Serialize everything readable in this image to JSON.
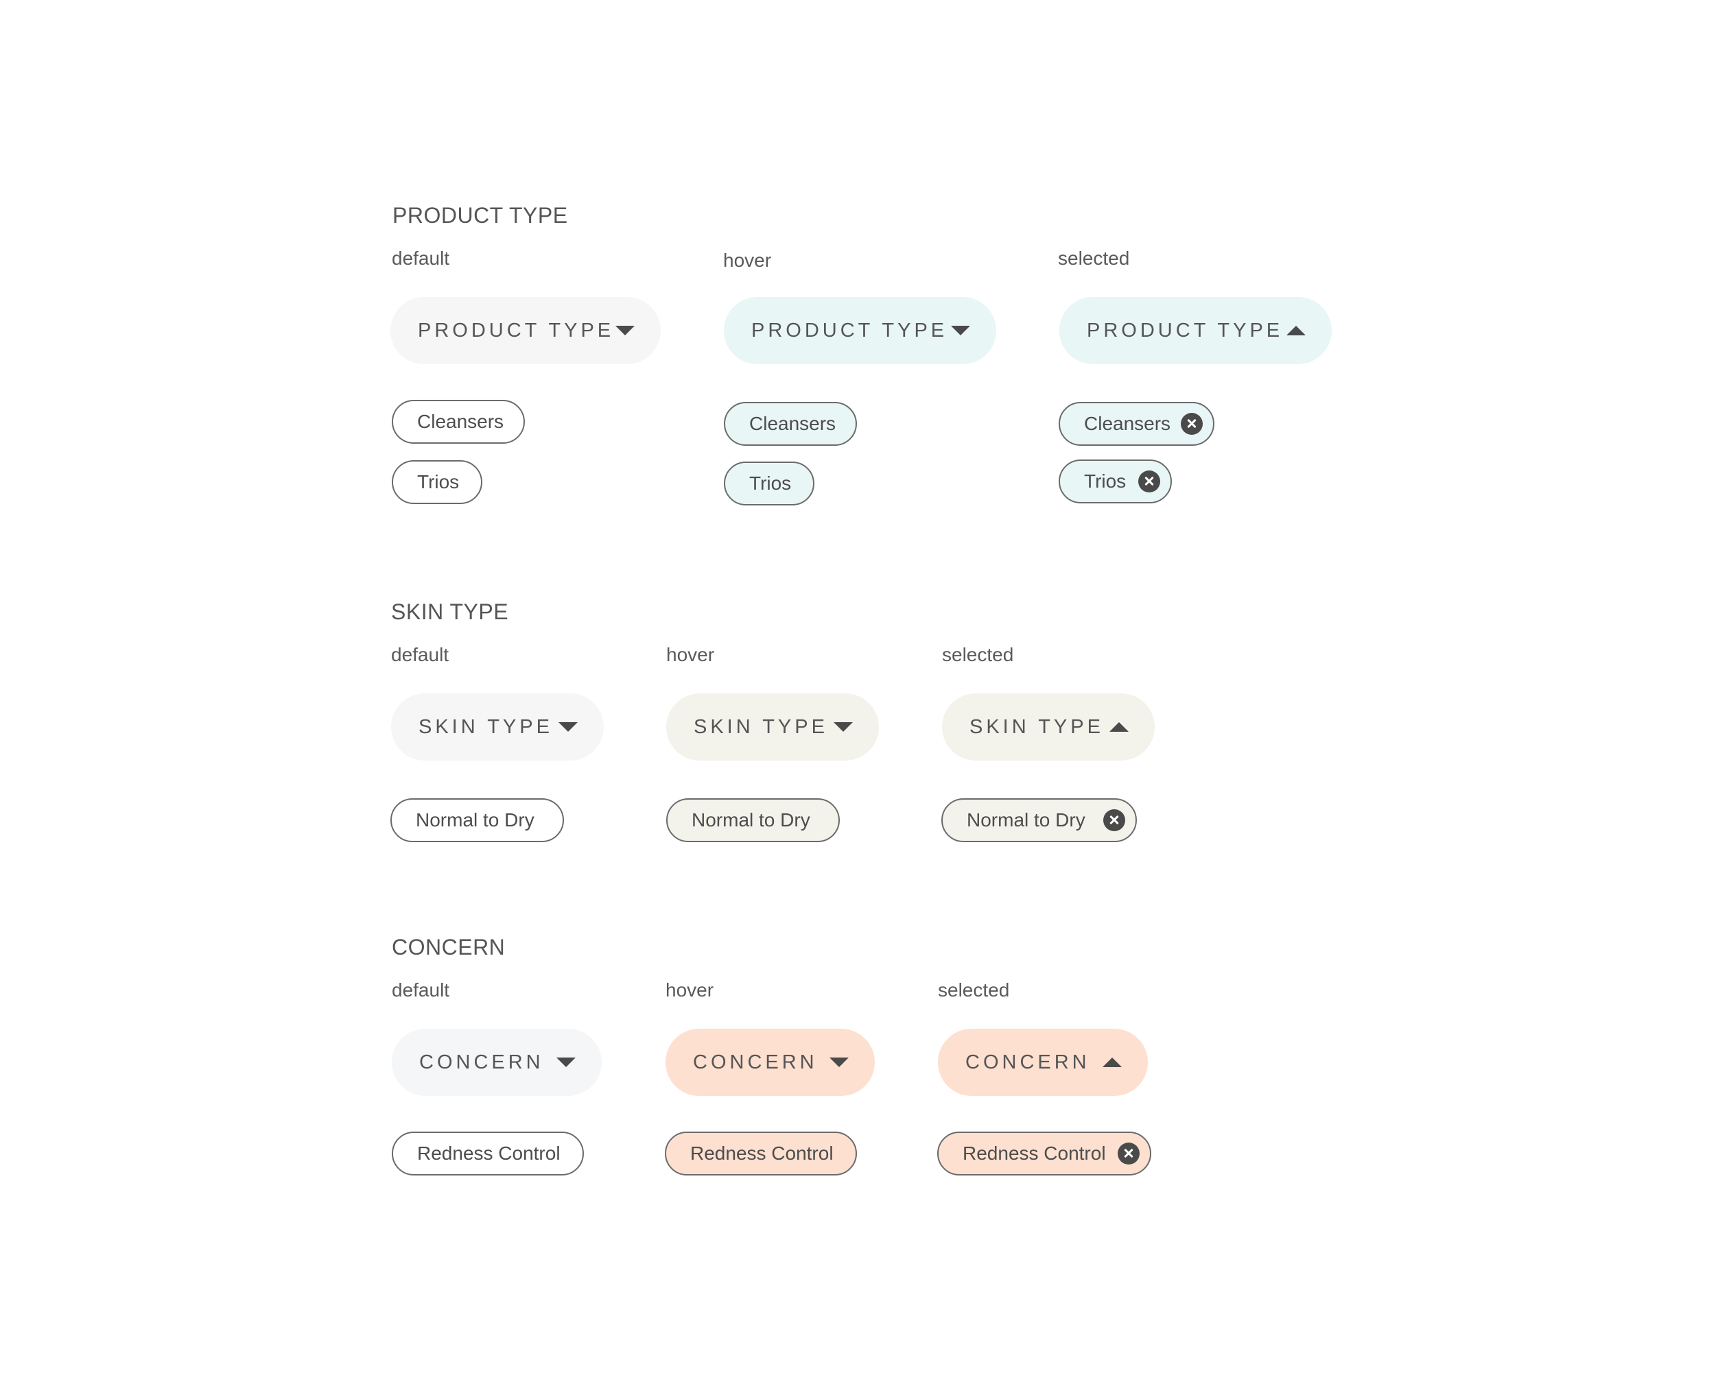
{
  "colors": {
    "default_bg": "#f6f6f6",
    "product_type_accent": "#e8f6f5",
    "skin_type_accent": "#f3f3eb",
    "concern_accent": "#fde0d0",
    "text": "#4d4d4d",
    "border": "#6b6b6b",
    "remove_icon": "#4a4a4a"
  },
  "sections": {
    "product_type": {
      "title": "PRODUCT TYPE",
      "default": {
        "state_label": "default",
        "dropdown_label": "PRODUCT TYPE",
        "caret_icon": "chevron-down-icon",
        "chips": [
          "Cleansers",
          "Trios"
        ]
      },
      "hover": {
        "state_label": "hover",
        "dropdown_label": "PRODUCT TYPE",
        "caret_icon": "chevron-down-icon",
        "chips": [
          "Cleansers",
          "Trios"
        ]
      },
      "selected": {
        "state_label": "selected",
        "dropdown_label": "PRODUCT TYPE",
        "caret_icon": "chevron-up-icon",
        "chips": [
          "Cleansers",
          "Trios"
        ],
        "chip_remove_icon": "close-circle-icon"
      }
    },
    "skin_type": {
      "title": "SKIN TYPE",
      "default": {
        "state_label": "default",
        "dropdown_label": "SKIN TYPE",
        "caret_icon": "chevron-down-icon",
        "chips": [
          "Normal to Dry"
        ]
      },
      "hover": {
        "state_label": "hover",
        "dropdown_label": "SKIN TYPE",
        "caret_icon": "chevron-down-icon",
        "chips": [
          "Normal to Dry"
        ]
      },
      "selected": {
        "state_label": "selected",
        "dropdown_label": "SKIN TYPE",
        "caret_icon": "chevron-up-icon",
        "chips": [
          "Normal to Dry"
        ],
        "chip_remove_icon": "close-circle-icon"
      }
    },
    "concern": {
      "title": "CONCERN",
      "default": {
        "state_label": "default",
        "dropdown_label": "CONCERN",
        "caret_icon": "chevron-down-icon",
        "chips": [
          "Redness Control"
        ]
      },
      "hover": {
        "state_label": "hover",
        "dropdown_label": "CONCERN",
        "caret_icon": "chevron-down-icon",
        "chips": [
          "Redness Control"
        ]
      },
      "selected": {
        "state_label": "selected",
        "dropdown_label": "CONCERN",
        "caret_icon": "chevron-up-icon",
        "chips": [
          "Redness Control"
        ],
        "chip_remove_icon": "close-circle-icon"
      }
    }
  }
}
